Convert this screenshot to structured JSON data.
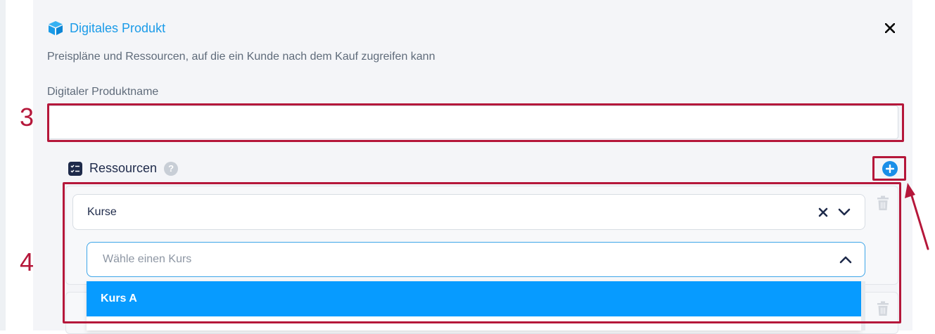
{
  "modal": {
    "title": "Digitales Produkt",
    "subtitle": "Preispläne und Ressourcen, auf die ein Kunde nach dem Kauf zugreifen kann",
    "close_icon": "close-icon",
    "header_icon": "box-icon"
  },
  "product_name": {
    "label": "Digitaler Produktname",
    "value": ""
  },
  "resources": {
    "label": "Ressourcen",
    "help_icon": "?",
    "items": [
      {
        "type_value": "Kurse",
        "search_placeholder": "Wähle einen Kurs",
        "options": [
          "Kurs A"
        ]
      }
    ]
  },
  "annotations": {
    "step_3": "3",
    "step_4": "4"
  },
  "colors": {
    "accent": "#1a9be8",
    "selected": "#079bff",
    "annotation": "#b5173a",
    "navy": "#1e2a4a"
  }
}
